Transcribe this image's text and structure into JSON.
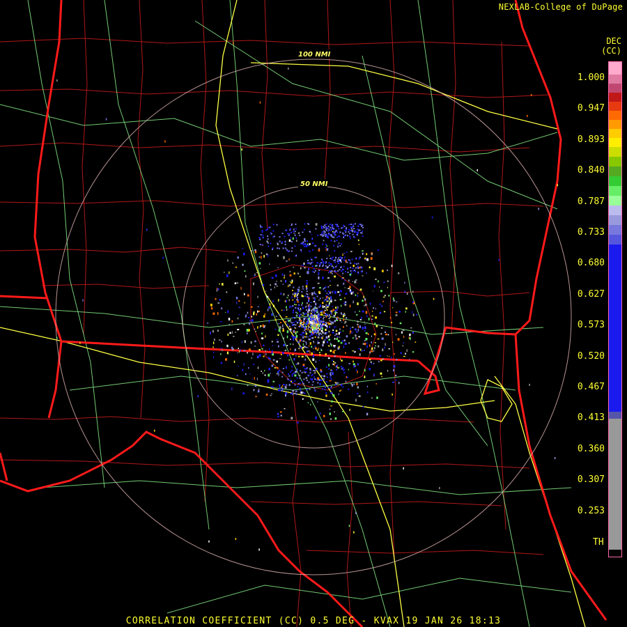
{
  "credit": "NEXLAB-College of DuPage",
  "units": {
    "line1": "DEC",
    "line2": "(CC)"
  },
  "scale": {
    "labels": [
      "1.000",
      "0.947",
      "0.893",
      "0.840",
      "0.787",
      "0.733",
      "0.680",
      "0.627",
      "0.573",
      "0.520",
      "0.467",
      "0.413",
      "0.360",
      "0.307",
      "0.253"
    ],
    "th_label": "TH"
  },
  "range_rings": [
    {
      "label": "100 NMI"
    },
    {
      "label": "50 NMI"
    }
  ],
  "footer": "CORRELATION COEFFICIENT (CC) 0.5 DEG - KVAX 19 JAN 26 18:13",
  "colors": {
    "background": "#000000",
    "state_borders": "#ff1a1a",
    "county_lines": "#b01818",
    "highways": "#ffff44",
    "roads": "#88ee88",
    "range_rings": "#e6b8b8",
    "text": "#ffff33"
  }
}
